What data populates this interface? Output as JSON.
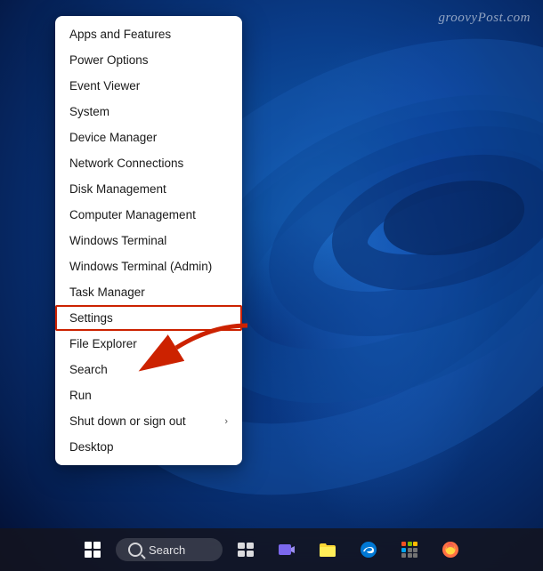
{
  "watermark": {
    "text": "groovyPost.com"
  },
  "context_menu": {
    "items": [
      {
        "id": "apps-features",
        "label": "Apps and Features",
        "has_arrow": false,
        "highlighted": false,
        "settings_outlined": false
      },
      {
        "id": "power-options",
        "label": "Power Options",
        "has_arrow": false,
        "highlighted": false,
        "settings_outlined": false
      },
      {
        "id": "event-viewer",
        "label": "Event Viewer",
        "has_arrow": false,
        "highlighted": false,
        "settings_outlined": false
      },
      {
        "id": "system",
        "label": "System",
        "has_arrow": false,
        "highlighted": false,
        "settings_outlined": false
      },
      {
        "id": "device-manager",
        "label": "Device Manager",
        "has_arrow": false,
        "highlighted": false,
        "settings_outlined": false
      },
      {
        "id": "network-connections",
        "label": "Network Connections",
        "has_arrow": false,
        "highlighted": false,
        "settings_outlined": false
      },
      {
        "id": "disk-management",
        "label": "Disk Management",
        "has_arrow": false,
        "highlighted": false,
        "settings_outlined": false
      },
      {
        "id": "computer-management",
        "label": "Computer Management",
        "has_arrow": false,
        "highlighted": false,
        "settings_outlined": false
      },
      {
        "id": "windows-terminal",
        "label": "Windows Terminal",
        "has_arrow": false,
        "highlighted": false,
        "settings_outlined": false
      },
      {
        "id": "windows-terminal-admin",
        "label": "Windows Terminal (Admin)",
        "has_arrow": false,
        "highlighted": false,
        "settings_outlined": false
      },
      {
        "id": "task-manager",
        "label": "Task Manager",
        "has_arrow": false,
        "highlighted": false,
        "settings_outlined": false
      },
      {
        "id": "settings",
        "label": "Settings",
        "has_arrow": false,
        "highlighted": false,
        "settings_outlined": true
      },
      {
        "id": "file-explorer",
        "label": "File Explorer",
        "has_arrow": false,
        "highlighted": false,
        "settings_outlined": false
      },
      {
        "id": "search",
        "label": "Search",
        "has_arrow": false,
        "highlighted": false,
        "settings_outlined": false
      },
      {
        "id": "run",
        "label": "Run",
        "has_arrow": false,
        "highlighted": false,
        "settings_outlined": false
      },
      {
        "id": "shut-down",
        "label": "Shut down or sign out",
        "has_arrow": true,
        "highlighted": false,
        "settings_outlined": false
      },
      {
        "id": "desktop",
        "label": "Desktop",
        "has_arrow": false,
        "highlighted": false,
        "settings_outlined": false
      }
    ]
  },
  "taskbar": {
    "search_label": "Search",
    "icons": [
      "windows-start",
      "search",
      "task-view",
      "teams",
      "file-explorer",
      "edge",
      "grid-apps",
      "firefox"
    ]
  }
}
